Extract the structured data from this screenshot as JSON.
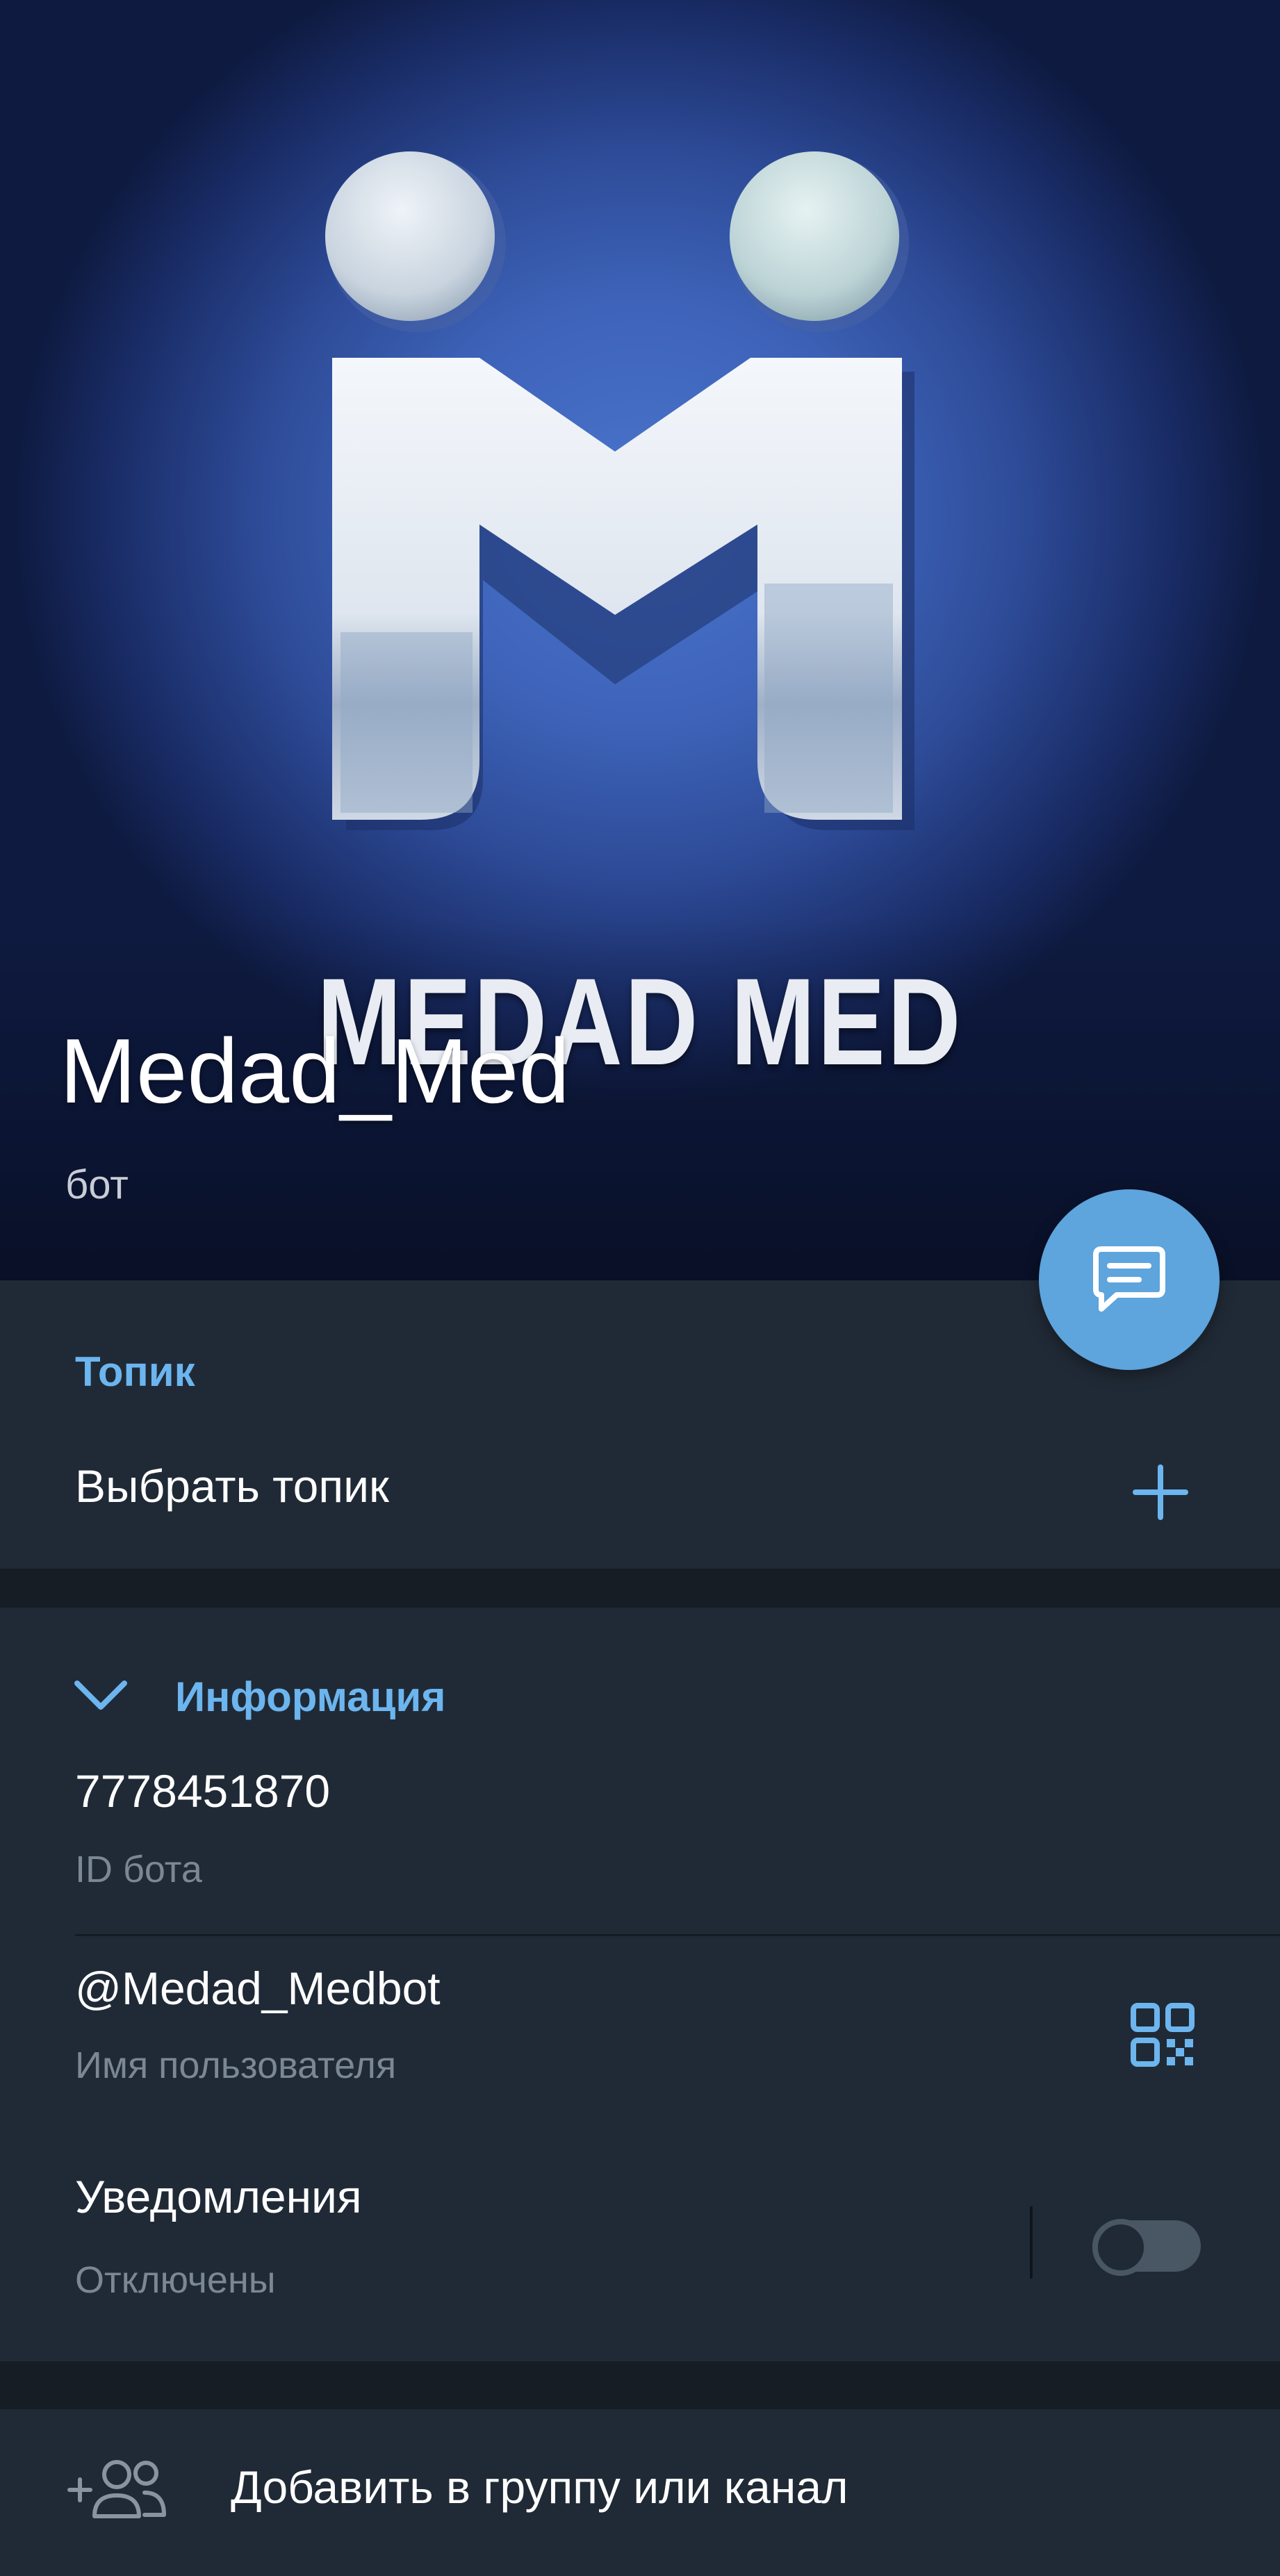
{
  "header": {
    "brand_text": "MEDAD MED",
    "title": "Medad_Med",
    "subtitle": "бот",
    "fab_icon": "message-icon"
  },
  "topic": {
    "section_title": "Топик",
    "choose_label": "Выбрать топик",
    "add_icon": "plus-icon"
  },
  "info": {
    "section_title": "Информация",
    "collapse_icon": "chevron-down-icon",
    "id_value": "7778451870",
    "id_caption": "ID бота",
    "username_value": "@Medad_Medbot",
    "username_caption": "Имя пользователя",
    "qr_icon": "qr-code-icon",
    "notifications_label": "Уведомления",
    "notifications_status": "Отключены",
    "notifications_enabled": false
  },
  "actions": {
    "add_to_group_label": "Добавить в группу или канал",
    "add_to_group_icon": "add-users-icon"
  },
  "colors": {
    "accent": "#6cb5ef",
    "fab": "#5ea4dd",
    "background": "#202a36"
  }
}
